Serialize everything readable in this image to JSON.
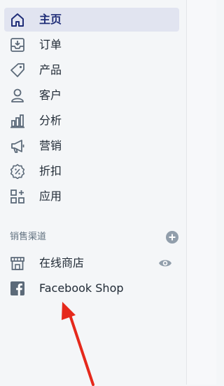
{
  "nav": {
    "items": [
      {
        "id": "home",
        "label": "主页",
        "icon": "home-icon",
        "active": true
      },
      {
        "id": "orders",
        "label": "订单",
        "icon": "orders-inbox-icon",
        "active": false
      },
      {
        "id": "products",
        "label": "产品",
        "icon": "tag-icon",
        "active": false
      },
      {
        "id": "customers",
        "label": "客户",
        "icon": "person-icon",
        "active": false
      },
      {
        "id": "analytics",
        "label": "分析",
        "icon": "bar-chart-icon",
        "active": false
      },
      {
        "id": "marketing",
        "label": "营销",
        "icon": "megaphone-icon",
        "active": false
      },
      {
        "id": "discounts",
        "label": "折扣",
        "icon": "discount-badge-icon",
        "active": false
      },
      {
        "id": "apps",
        "label": "应用",
        "icon": "apps-grid-icon",
        "active": false
      }
    ]
  },
  "sales_channels": {
    "title": "销售渠道",
    "add_icon": "plus-circle-icon",
    "items": [
      {
        "id": "online-store",
        "label": "在线商店",
        "icon": "storefront-icon",
        "action_icon": "eye-icon"
      },
      {
        "id": "facebook-shop",
        "label": "Facebook Shop",
        "icon": "facebook-icon"
      }
    ]
  },
  "colors": {
    "active_bg": "#e1e4f0",
    "active_text": "#202e78",
    "icon": "#5c6a79",
    "annotation_arrow": "#e5291c"
  }
}
